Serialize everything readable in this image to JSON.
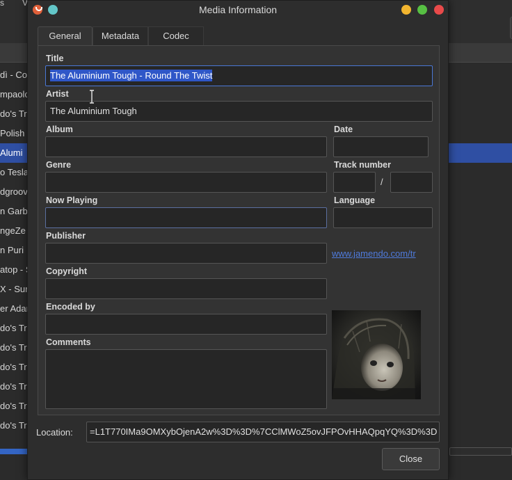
{
  "background": {
    "top_fragments": [
      "s",
      "V"
    ],
    "list_rows": [
      {
        "text": "dì - Cor",
        "selected": false
      },
      {
        "text": "mpaolo",
        "selected": false
      },
      {
        "text": "do's Tre",
        "selected": false
      },
      {
        "text": "Polish",
        "selected": false
      },
      {
        "text": "Alumi",
        "selected": true
      },
      {
        "text": "o Tesla",
        "selected": false
      },
      {
        "text": "dgroov",
        "selected": false
      },
      {
        "text": "n Garb",
        "selected": false
      },
      {
        "text": "ngeZe",
        "selected": false
      },
      {
        "text": "n Puri",
        "selected": false
      },
      {
        "text": "atop - S",
        "selected": false
      },
      {
        "text": "X - Surv",
        "selected": false
      },
      {
        "text": "er Adar",
        "selected": false
      },
      {
        "text": "do's Tre",
        "selected": false
      },
      {
        "text": "do's Tre",
        "selected": false
      },
      {
        "text": "do's Tre",
        "selected": false
      },
      {
        "text": "do's Tre",
        "selected": false
      },
      {
        "text": "do's Tre",
        "selected": false
      },
      {
        "text": "do's Tre",
        "selected": false
      }
    ]
  },
  "dialog": {
    "title": "Media Information",
    "tabs": [
      {
        "label": "General",
        "active": true
      },
      {
        "label": "Metadata",
        "active": false
      },
      {
        "label": "Codec",
        "active": false
      }
    ],
    "fields": {
      "title": {
        "label": "Title",
        "value": "The Aluminium Tough - Round The Twist"
      },
      "artist": {
        "label": "Artist",
        "value": "The Aluminium Tough"
      },
      "album": {
        "label": "Album",
        "value": ""
      },
      "date": {
        "label": "Date",
        "value": ""
      },
      "genre": {
        "label": "Genre",
        "value": ""
      },
      "track_number": {
        "label": "Track number",
        "value": "",
        "total": "",
        "separator": "/"
      },
      "now_playing": {
        "label": "Now Playing",
        "value": ""
      },
      "language": {
        "label": "Language",
        "value": ""
      },
      "publisher": {
        "label": "Publisher",
        "value": ""
      },
      "publisher_link": "www.jamendo.com/tr",
      "copyright": {
        "label": "Copyright",
        "value": ""
      },
      "encoded_by": {
        "label": "Encoded by",
        "value": ""
      },
      "comments": {
        "label": "Comments",
        "value": ""
      }
    },
    "location": {
      "label": "Location:",
      "value": "=L1T770IMa9OMXybOjenA2w%3D%3D%7CClMWoZ5ovJFPOvHHAQpqYQ%3D%3D"
    },
    "close_label": "Close"
  }
}
